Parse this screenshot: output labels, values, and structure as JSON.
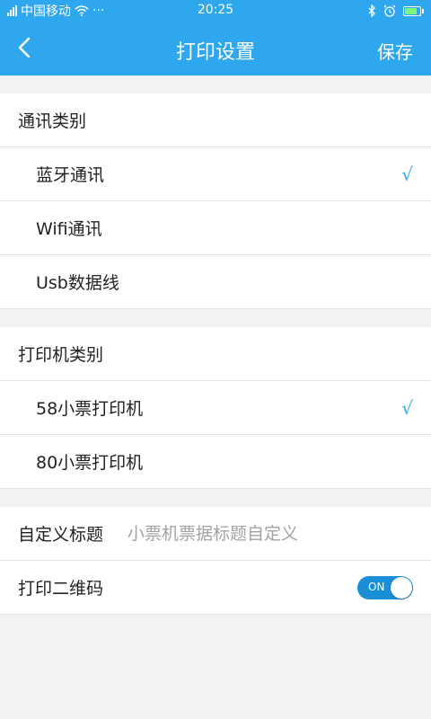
{
  "status_bar": {
    "carrier": "中国移动",
    "more": "···",
    "time": "20:25"
  },
  "navbar": {
    "title": "打印设置",
    "save_label": "保存"
  },
  "communication": {
    "header": "通讯类别",
    "options": [
      {
        "label": "蓝牙通讯",
        "selected": true
      },
      {
        "label": "Wifi通讯",
        "selected": false
      },
      {
        "label": "Usb数据线",
        "selected": false
      }
    ]
  },
  "printer": {
    "header": "打印机类别",
    "options": [
      {
        "label": "58小票打印机",
        "selected": true
      },
      {
        "label": "80小票打印机",
        "selected": false
      }
    ]
  },
  "custom_title": {
    "label": "自定义标题",
    "value": "",
    "placeholder": "小票机票据标题自定义"
  },
  "qr_code": {
    "label": "打印二维码",
    "toggle_text": "ON",
    "enabled": true
  },
  "check_mark": "√",
  "colors": {
    "accent": "#2ea7ee",
    "toggle_on": "#1a8fd8",
    "background": "#f2f2f4"
  }
}
